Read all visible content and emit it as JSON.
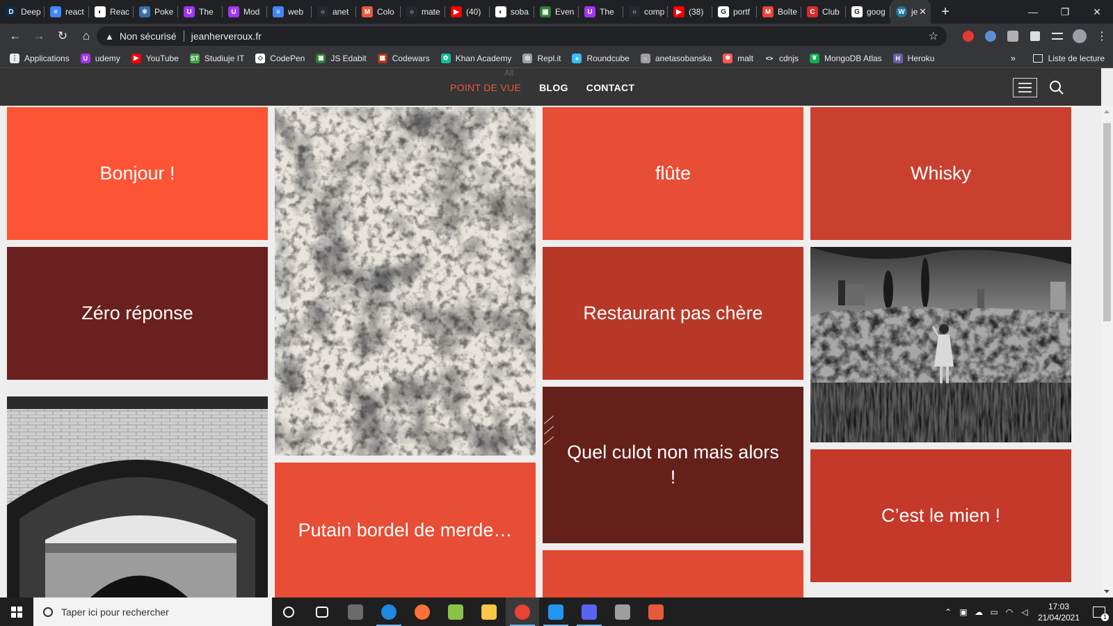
{
  "browser": {
    "tabs": [
      {
        "label": "Deep",
        "color": "#0f2b46",
        "glyph": "D"
      },
      {
        "label": "react",
        "color": "#4285f4",
        "glyph": "≡"
      },
      {
        "label": "Reac",
        "color": "#ffffff",
        "glyph": "◐"
      },
      {
        "label": "Poke",
        "color": "#3b6ea5",
        "glyph": "⚛"
      },
      {
        "label": "The",
        "color": "#a435f0",
        "glyph": "U"
      },
      {
        "label": "Mod",
        "color": "#a435f0",
        "glyph": "U"
      },
      {
        "label": "web",
        "color": "#4285f4",
        "glyph": "≡"
      },
      {
        "label": "anet",
        "color": "#24292e",
        "glyph": "○"
      },
      {
        "label": "Colo",
        "color": "#e8593c",
        "glyph": "M"
      },
      {
        "label": "mate",
        "color": "#24292e",
        "glyph": "○"
      },
      {
        "label": "(40)",
        "color": "#ff0000",
        "glyph": "▶"
      },
      {
        "label": "soba",
        "color": "#ffffff",
        "glyph": "◐"
      },
      {
        "label": "Even",
        "color": "#2e7d32",
        "glyph": "▣"
      },
      {
        "label": "The",
        "color": "#a435f0",
        "glyph": "U"
      },
      {
        "label": "comp",
        "color": "#24292e",
        "glyph": "○"
      },
      {
        "label": "(38)",
        "color": "#ff0000",
        "glyph": "▶"
      },
      {
        "label": "portf",
        "color": "#ffffff",
        "glyph": "G"
      },
      {
        "label": "Boîte",
        "color": "#ea4335",
        "glyph": "M"
      },
      {
        "label": "Club",
        "color": "#d32f2f",
        "glyph": "C"
      },
      {
        "label": "goog",
        "color": "#ffffff",
        "glyph": "G"
      }
    ],
    "active_tab": {
      "label": "je",
      "glyph": "W"
    },
    "new_tab": "+",
    "window_controls": {
      "minimize": "—",
      "restore": "❐",
      "close": "✕"
    },
    "address": {
      "warning": "▲",
      "security_label": "Non sécurisé",
      "url": "jeanherveroux.fr"
    },
    "bookmarks": [
      {
        "label": "Applications",
        "color": "#e8eaed",
        "glyph": "⋮"
      },
      {
        "label": "udemy",
        "color": "#a435f0",
        "glyph": "U"
      },
      {
        "label": "YouTube",
        "color": "#ff0000",
        "glyph": "▶"
      },
      {
        "label": "Studiuje IT",
        "color": "#43a047",
        "glyph": "ST"
      },
      {
        "label": "CodePen",
        "color": "#ffffff",
        "glyph": "◇"
      },
      {
        "label": "JS Edabit",
        "color": "#2e7d32",
        "glyph": "▣"
      },
      {
        "label": "Codewars",
        "color": "#b1361e",
        "glyph": "▦"
      },
      {
        "label": "Khan Academy",
        "color": "#14bf96",
        "glyph": "✿"
      },
      {
        "label": "Repl.it",
        "color": "#9e9e9e",
        "glyph": "◎"
      },
      {
        "label": "Roundcube",
        "color": "#37beff",
        "glyph": "●"
      },
      {
        "label": "anetasobanska",
        "color": "#9e9e9e",
        "glyph": "○"
      },
      {
        "label": "malt",
        "color": "#fc5757",
        "glyph": "✱"
      },
      {
        "label": "cdnjs",
        "color": "#35363a",
        "glyph": "<>"
      },
      {
        "label": "MongoDB Atlas",
        "color": "#13aa52",
        "glyph": "❦"
      },
      {
        "label": "Heroku",
        "color": "#6762a6",
        "glyph": "H"
      }
    ],
    "bookmarks_more": "»",
    "reading_list": "Liste de lecture"
  },
  "site": {
    "header_hint": "All",
    "nav": [
      {
        "label": "POINT DE VUE",
        "current": true
      },
      {
        "label": "BLOG",
        "current": false
      },
      {
        "label": "CONTACT",
        "current": false
      }
    ],
    "tiles": {
      "bonjour": {
        "text": "Bonjour !",
        "color": "#fd5436"
      },
      "zero": {
        "text": "Zéro réponse",
        "color": "#6a211e"
      },
      "flute": {
        "text": "flûte",
        "color": "#e84d35"
      },
      "whisky": {
        "text": "Whisky",
        "color": "#c9402f"
      },
      "restaurant": {
        "text": "Restaurant pas chère",
        "color": "#b83828"
      },
      "culot": {
        "text": "Quel culot non mais alors !",
        "color": "#65201a"
      },
      "putain": {
        "text": "Putain bordel de merde…",
        "color": "#e84d35"
      },
      "mien": {
        "text": "C’est le mien !",
        "color": "#c4392a"
      },
      "partial": {
        "text": "",
        "color": "#e04a33"
      }
    },
    "photos": {
      "bridge": "bridge-arch-photo",
      "texture": "stone-texture-photo",
      "girl": "girl-by-wall-photo"
    }
  },
  "taskbar": {
    "search_placeholder": "Taper ici pour rechercher",
    "apps": [
      {
        "name": "task-view",
        "color": "#1f1f1f"
      },
      {
        "name": "explorer-app",
        "color": "#6b6b6b"
      },
      {
        "name": "edge",
        "color": "#1e88e5"
      },
      {
        "name": "firefox",
        "color": "#ff7139"
      },
      {
        "name": "notepad-plus",
        "color": "#8bc34a"
      },
      {
        "name": "file-explorer",
        "color": "#f9c646"
      },
      {
        "name": "chrome",
        "color": "#ea4335"
      },
      {
        "name": "vscode",
        "color": "#2196f3"
      },
      {
        "name": "discord",
        "color": "#5865f2"
      },
      {
        "name": "photos",
        "color": "#9e9e9e"
      },
      {
        "name": "audio",
        "color": "#e8593c"
      }
    ],
    "time": "17:03",
    "date": "21/04/2021",
    "notifications": "1"
  }
}
